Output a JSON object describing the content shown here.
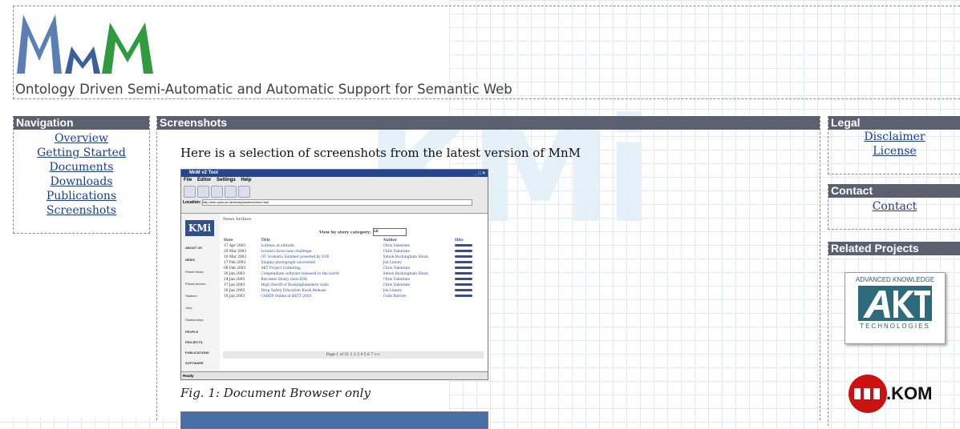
{
  "header": {
    "logo_text": "MnM",
    "tagline": "Ontology Driven Semi-Automatic and Automatic Support for Semantic Web"
  },
  "navigation": {
    "title": "Navigation",
    "items": [
      "Overview",
      "Getting Started",
      "Documents",
      "Downloads",
      "Publications",
      "Screenshots"
    ]
  },
  "main": {
    "title": "Screenshots",
    "intro": "Here is a selection of screenshots from the latest version of MnM",
    "figure1": {
      "caption": "Fig. 1: Document Browser only",
      "window_title": "MnM v2 Tool",
      "menu": [
        "File",
        "Editor",
        "Settings",
        "Help"
      ],
      "location_label": "Location:",
      "location_url": "http://kmi.open.ac.uk/news/planet/archive.html",
      "page_heading": "News Archive",
      "filter_label": "View by story category:",
      "filter_value": "All",
      "columns": [
        "Date",
        "Title",
        "Author",
        "Hits"
      ],
      "rows": [
        {
          "date": "17 Apr 2003",
          "title": "Lorenzo at altitude",
          "author": "Chris Valentine"
        },
        {
          "date": "20 Mar 2003",
          "title": "Lorenzo faces new challenge",
          "author": "Chris Valentine"
        },
        {
          "date": "10 Mar 2003",
          "title": "OU Scenario Summer powered by D3E",
          "author": "Simon Buckingham Shum"
        },
        {
          "date": "17 Feb 2003",
          "title": "Enigma photograph uncovered",
          "author": "Jon Linney"
        },
        {
          "date": "06 Feb 2003",
          "title": "AKT Project Gathering",
          "author": "Chris Valentine"
        },
        {
          "date": "30 Jan 2003",
          "title": "Compendium software released to the world",
          "author": "Simon Buckingham Shum"
        },
        {
          "date": "24 Jan 2003",
          "title": "Baroness Sharp visits KMi",
          "author": "Chris Valentine"
        },
        {
          "date": "17 Jan 2003",
          "title": "High Sheriff of Buckinghamshire visits",
          "author": "Chris Valentine"
        },
        {
          "date": "16 Jan 2003",
          "title": "Drug Safety Education Kiosk Release",
          "author": "Jon Linney"
        },
        {
          "date": "10 Jan 2003",
          "title": "CARER Online at BETT 2003",
          "author": "Colin Barrett"
        }
      ],
      "pager": "Page 1 of 21   1 2 3 4 5 6 7 >>",
      "status": "Ready",
      "side_nav": [
        "ABOUT US",
        "NEWS",
        "Planet News",
        "Planet Archive",
        "Stadium",
        "Jobs",
        "Stadiumclips",
        "PEOPLE",
        "PROJECTS",
        "PUBLICATIONS",
        "SOFTWARE"
      ],
      "kmi_logo": "KMi"
    }
  },
  "legal": {
    "title": "Legal",
    "items": [
      "Disclaimer",
      "License"
    ]
  },
  "contact": {
    "title": "Contact",
    "items": [
      "Contact"
    ]
  },
  "related": {
    "title": "Related Projects",
    "akt_top": "ADVANCED KNOWLEDGE",
    "akt_bottom": "TECHNOLOGIES",
    "dotkom": ".KOM"
  },
  "watermark": "KMi"
}
